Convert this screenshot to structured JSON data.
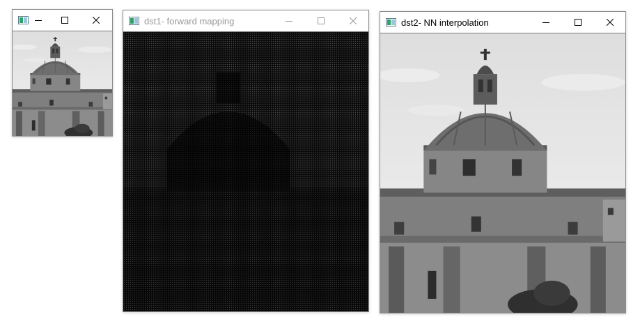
{
  "windows": {
    "src": {
      "title": ""
    },
    "dst1": {
      "title": "dst1- forward mapping"
    },
    "dst2": {
      "title": "dst2- NN interpolation"
    }
  },
  "icons": {
    "app": "opencv-window-icon",
    "minimize": "minimize-icon",
    "maximize": "maximize-icon",
    "close": "close-icon"
  },
  "colors": {
    "active_title_text": "#000000",
    "inactive_title_text": "#999999",
    "dst1_background": "#0d0d0d"
  }
}
